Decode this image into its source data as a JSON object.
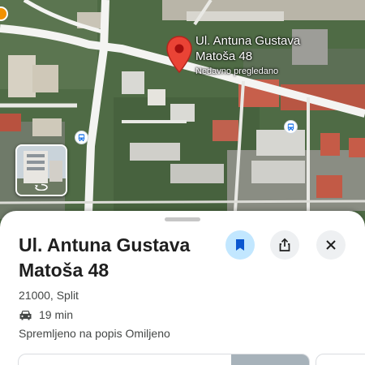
{
  "map": {
    "pin_title_line1": "Ul. Antuna Gustava",
    "pin_title_line2": "Matoša 48",
    "pin_subtitle": "Nedavno pregledano",
    "pin_icon": "red-location-pin",
    "transit_icon": "bus-stop-icon",
    "street_view_icon": "street-view-rotate-icon",
    "colors": {
      "pin": "#ea4335",
      "road": "#ffffff",
      "vegetation": "#4f6b45"
    }
  },
  "place": {
    "title_line1": "Ul. Antuna Gustava",
    "title_line2": "Matoša 48",
    "postal": "21000, Split",
    "drive_time": "19 min",
    "saved_status": "Spremljeno na popis Omiljeno"
  },
  "actions": {
    "save_icon": "bookmark-icon",
    "share_icon": "share-icon",
    "close_icon": "close-icon",
    "colors": {
      "save_bg": "#c2e7ff",
      "save_fg": "#0b57d0",
      "neutral_bg": "#eef0f2"
    }
  }
}
